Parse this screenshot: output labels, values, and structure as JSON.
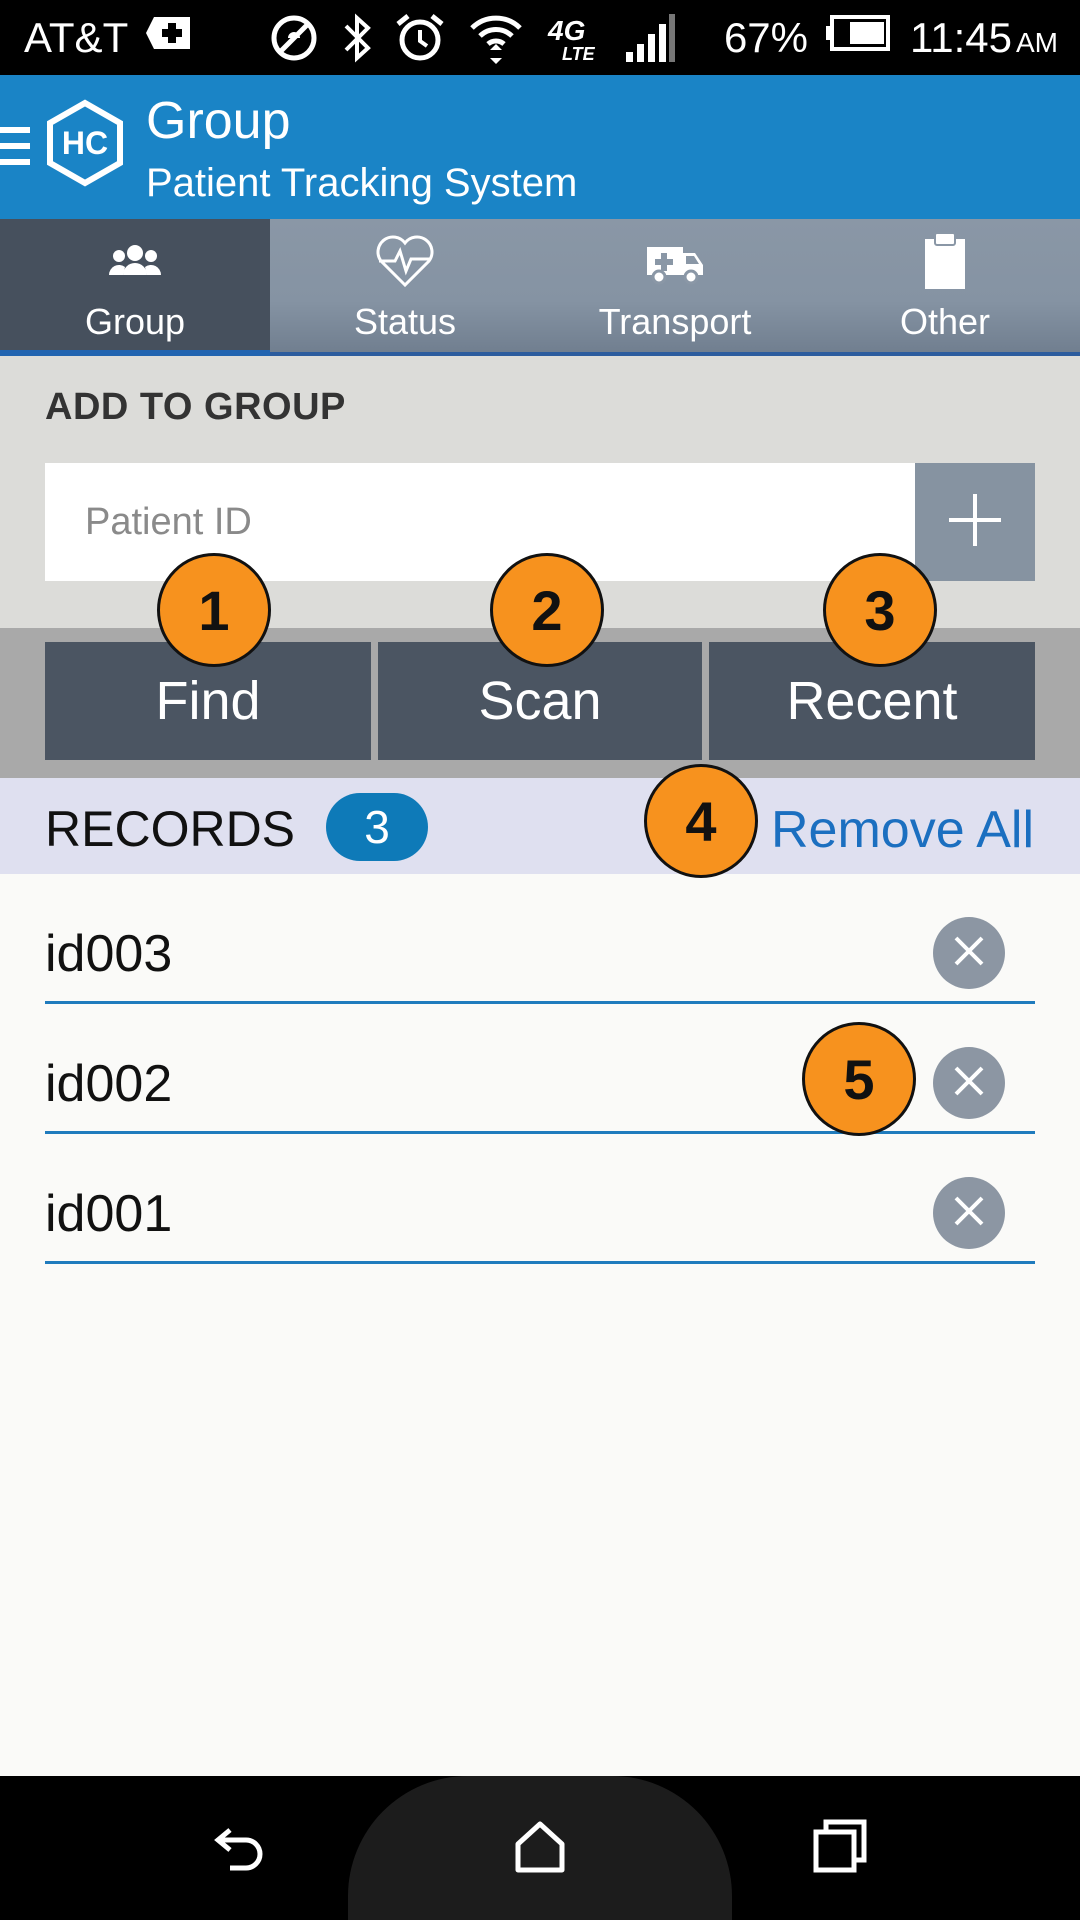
{
  "status_bar": {
    "carrier": "AT&T",
    "network": "4G LTE",
    "battery": "67%",
    "time": "11:45",
    "ampm": "AM"
  },
  "app_bar": {
    "title": "Group",
    "subtitle": "Patient Tracking System",
    "logo_text": "HC"
  },
  "tabs": [
    {
      "label": "Group",
      "icon": "group-icon",
      "active": true
    },
    {
      "label": "Status",
      "icon": "heart-pulse-icon",
      "active": false
    },
    {
      "label": "Transport",
      "icon": "ambulance-icon",
      "active": false
    },
    {
      "label": "Other",
      "icon": "clipboard-icon",
      "active": false
    }
  ],
  "add_to_group": {
    "heading": "ADD TO GROUP",
    "input_placeholder": "Patient ID",
    "input_value": ""
  },
  "actions": {
    "find": "Find",
    "scan": "Scan",
    "recent": "Recent"
  },
  "records": {
    "title": "RECORDS",
    "count": "3",
    "remove_all": "Remove All",
    "items": [
      "id003",
      "id002",
      "id001"
    ]
  },
  "callouts": [
    "1",
    "2",
    "3",
    "4",
    "5"
  ],
  "colors": {
    "app_bar": "#1a84c6",
    "active_tab": "#46505d",
    "button": "#4b5562",
    "callout": "#f7921e",
    "link": "#1b6fc0",
    "badge": "#0e7ab8"
  }
}
